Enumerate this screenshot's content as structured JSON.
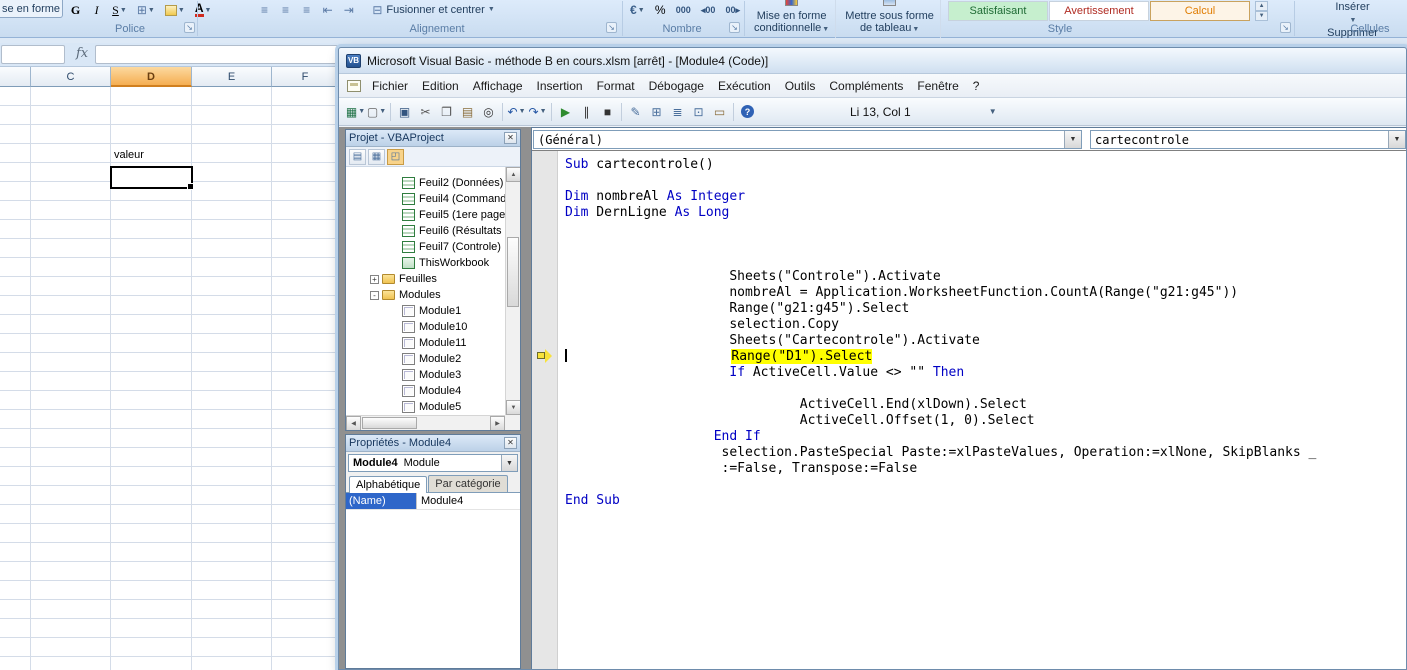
{
  "excel": {
    "top_left_partial": "se en forme",
    "groups": {
      "police": {
        "label": "Police",
        "bold": "G",
        "italic": "I",
        "underline": "S"
      },
      "alignement": {
        "label": "Alignement",
        "merge": "Fusionner et centrer"
      },
      "nombre": {
        "label": "Nombre",
        "percent": "%",
        "thousands": "000"
      },
      "style": {
        "label": "Style",
        "btn1_line1": "Mise en forme",
        "btn1_line2": "conditionnelle",
        "btn2_line1": "Mettre sous forme",
        "btn2_line2": "de tableau",
        "gallery": [
          {
            "label": "Satisfaisant",
            "bg": "#c6efce",
            "fg": "#1f6b35",
            "border": "#c7d2de"
          },
          {
            "label": "Avertissement",
            "bg": "#ffffff",
            "fg": "#b02b22",
            "border": "#c7d2de"
          },
          {
            "label": "Calcul",
            "bg": "#fdf4e7",
            "fg": "#e07c00",
            "border": "#c9a25e"
          }
        ]
      },
      "cellules": {
        "label": "Cellules",
        "insert": "Insérer",
        "delete": "Supprimer"
      }
    },
    "formula_bar": {
      "fx": "fx"
    },
    "columns": [
      "C",
      "D",
      "E",
      "F"
    ],
    "selected_column": "D",
    "cell_text": "valeur"
  },
  "vbe": {
    "title": "Microsoft Visual Basic - méthode B en cours.xlsm [arrêt] - [Module4 (Code)]",
    "app_icon_text": "VB",
    "menus": [
      "Fichier",
      "Edition",
      "Affichage",
      "Insertion",
      "Format",
      "Débogage",
      "Exécution",
      "Outils",
      "Compléments",
      "Fenêtre",
      "?"
    ],
    "toolbar": {
      "position": "Li 13, Col 1",
      "icons": [
        {
          "name": "view-excel-icon",
          "g": "▦",
          "c": "#1d7044",
          "dd": true
        },
        {
          "name": "insert-userform-icon",
          "g": "▢",
          "c": "#666666",
          "dd": true
        },
        {
          "name": "save-icon",
          "g": "▣",
          "c": "#33557f"
        },
        {
          "name": "cut-icon",
          "g": "✂",
          "c": "#555555"
        },
        {
          "name": "copy-icon",
          "g": "❐",
          "c": "#555555"
        },
        {
          "name": "paste-icon",
          "g": "▤",
          "c": "#8a6d3b"
        },
        {
          "name": "find-icon",
          "g": "◎",
          "c": "#333333"
        },
        {
          "name": "undo-icon",
          "g": "↶",
          "c": "#2456a4",
          "dd": true
        },
        {
          "name": "redo-icon",
          "g": "↷",
          "c": "#2456a4",
          "dd": true
        },
        {
          "name": "run-icon",
          "g": "▶",
          "c": "#2e8b2e"
        },
        {
          "name": "break-icon",
          "g": "∥",
          "c": "#333333"
        },
        {
          "name": "reset-icon",
          "g": "■",
          "c": "#333333"
        },
        {
          "name": "design-mode-icon",
          "g": "✎",
          "c": "#4a6f9c"
        },
        {
          "name": "project-explorer-icon",
          "g": "⊞",
          "c": "#4a6f9c"
        },
        {
          "name": "properties-window-icon",
          "g": "≣",
          "c": "#4a6f9c"
        },
        {
          "name": "object-browser-icon",
          "g": "⊡",
          "c": "#4a6f9c"
        },
        {
          "name": "toolbox-icon",
          "g": "▭",
          "c": "#8a6d3b"
        },
        {
          "name": "help-icon",
          "g": "?",
          "c": "#ffffff",
          "help": true
        }
      ]
    },
    "project": {
      "title": "Projet - VBAProject",
      "items": [
        {
          "label": "Feuil2 (Données)",
          "icon": "sheet",
          "indent": 2
        },
        {
          "label": "Feuil4 (Command",
          "icon": "sheet",
          "indent": 2
        },
        {
          "label": "Feuil5 (1ere page",
          "icon": "sheet",
          "indent": 2
        },
        {
          "label": "Feuil6 (Résultats",
          "icon": "sheet",
          "indent": 2
        },
        {
          "label": "Feuil7 (Controle)",
          "icon": "sheet",
          "indent": 2
        },
        {
          "label": "ThisWorkbook",
          "icon": "workbook",
          "indent": 2
        },
        {
          "label": "Feuilles",
          "icon": "folder",
          "expander": "+",
          "indent": 1
        },
        {
          "label": "Modules",
          "icon": "folder-open",
          "expander": "-",
          "indent": 1
        },
        {
          "label": "Module1",
          "icon": "module",
          "indent": 2
        },
        {
          "label": "Module10",
          "icon": "module",
          "indent": 2
        },
        {
          "label": "Module11",
          "icon": "module",
          "indent": 2
        },
        {
          "label": "Module2",
          "icon": "module",
          "indent": 2
        },
        {
          "label": "Module3",
          "icon": "module",
          "indent": 2
        },
        {
          "label": "Module4",
          "icon": "module",
          "indent": 2
        },
        {
          "label": "Module5",
          "icon": "module",
          "indent": 2
        }
      ]
    },
    "properties": {
      "title": "Propriétés - Module4",
      "selector_name": "Module4",
      "selector_type": "Module",
      "tabs": [
        "Alphabétique",
        "Par catégorie"
      ],
      "rows": [
        {
          "name": "(Name)",
          "value": "Module4"
        }
      ]
    },
    "code": {
      "left_combo": "(Général)",
      "right_combo": "cartecontrole",
      "lines": [
        {
          "segs": [
            {
              "k": "k",
              "t": "Sub"
            },
            {
              "k": "p",
              "t": " cartecontrole()"
            }
          ]
        },
        {
          "segs": []
        },
        {
          "segs": [
            {
              "k": "k",
              "t": "Dim"
            },
            {
              "k": "p",
              "t": " nombreAl "
            },
            {
              "k": "k",
              "t": "As"
            },
            {
              "k": "p",
              "t": " "
            },
            {
              "k": "k",
              "t": "Integer"
            }
          ]
        },
        {
          "segs": [
            {
              "k": "k",
              "t": "Dim"
            },
            {
              "k": "p",
              "t": " DernLigne "
            },
            {
              "k": "k",
              "t": "As"
            },
            {
              "k": "p",
              "t": " "
            },
            {
              "k": "k",
              "t": "Long"
            }
          ]
        },
        {
          "segs": []
        },
        {
          "segs": []
        },
        {
          "segs": []
        },
        {
          "segs": [
            {
              "k": "p",
              "t": "                     Sheets(\"Controle\").Activate"
            }
          ]
        },
        {
          "segs": [
            {
              "k": "p",
              "t": "                     nombreAl = Application.WorksheetFunction.CountA(Range(\"g21:g45\"))"
            }
          ]
        },
        {
          "segs": [
            {
              "k": "p",
              "t": "                     Range(\"g21:g45\").Select"
            }
          ]
        },
        {
          "segs": [
            {
              "k": "p",
              "t": "                     selection.Copy"
            }
          ]
        },
        {
          "segs": [
            {
              "k": "p",
              "t": "                     Sheets(\"Cartecontrole\").Activate"
            }
          ]
        },
        {
          "caret": true,
          "segs": [
            {
              "k": "p",
              "t": "                     "
            },
            {
              "k": "h",
              "t": "Range(\"D1\").Select"
            }
          ]
        },
        {
          "segs": [
            {
              "k": "p",
              "t": "                     "
            },
            {
              "k": "k",
              "t": "If"
            },
            {
              "k": "p",
              "t": " ActiveCell.Value <> \"\" "
            },
            {
              "k": "k",
              "t": "Then"
            }
          ]
        },
        {
          "segs": []
        },
        {
          "segs": [
            {
              "k": "p",
              "t": "                              ActiveCell.End(xlDown).Select"
            }
          ]
        },
        {
          "segs": [
            {
              "k": "p",
              "t": "                              ActiveCell.Offset(1, 0).Select"
            }
          ]
        },
        {
          "segs": [
            {
              "k": "p",
              "t": "                   "
            },
            {
              "k": "k",
              "t": "End If"
            }
          ]
        },
        {
          "segs": [
            {
              "k": "p",
              "t": "                    selection.PasteSpecial Paste:=xlPasteValues, Operation:=xlNone, SkipBlanks _"
            }
          ]
        },
        {
          "segs": [
            {
              "k": "p",
              "t": "                    :=False, Transpose:=False"
            }
          ]
        },
        {
          "segs": []
        },
        {
          "segs": [
            {
              "k": "k",
              "t": "End Sub"
            }
          ]
        }
      ]
    }
  }
}
